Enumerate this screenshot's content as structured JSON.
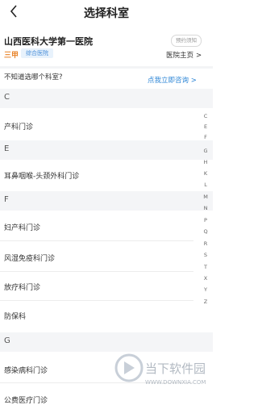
{
  "header": {
    "title": "选择科室"
  },
  "hospital": {
    "name": "山西医科大学第一医院",
    "notice_button": "预约须知",
    "level": "三甲",
    "type": "综合医院",
    "home_link": "医院主页",
    "home_chevron": ">"
  },
  "prompt": {
    "question": "不知道选哪个科室?",
    "consult_link": "点我立即咨询 >"
  },
  "sections": [
    {
      "letter": "C",
      "items": [
        "产科门诊"
      ]
    },
    {
      "letter": "E",
      "items": [
        "耳鼻咽喉-头颈外科门诊"
      ]
    },
    {
      "letter": "F",
      "items": [
        "妇产科门诊",
        "风湿免疫科门诊",
        "放疗科门诊",
        "防保科"
      ]
    },
    {
      "letter": "G",
      "items": [
        "感染病科门诊",
        "公费医疗门诊"
      ]
    }
  ],
  "index_letters": [
    "C",
    "E",
    "F",
    "G",
    "H",
    "K",
    "L",
    "M",
    "N",
    "P",
    "Q",
    "R",
    "S",
    "T",
    "X",
    "Y",
    "Z"
  ],
  "watermark": {
    "text": "当下软件园",
    "url": "WWW.DOWNXIA.COM"
  }
}
